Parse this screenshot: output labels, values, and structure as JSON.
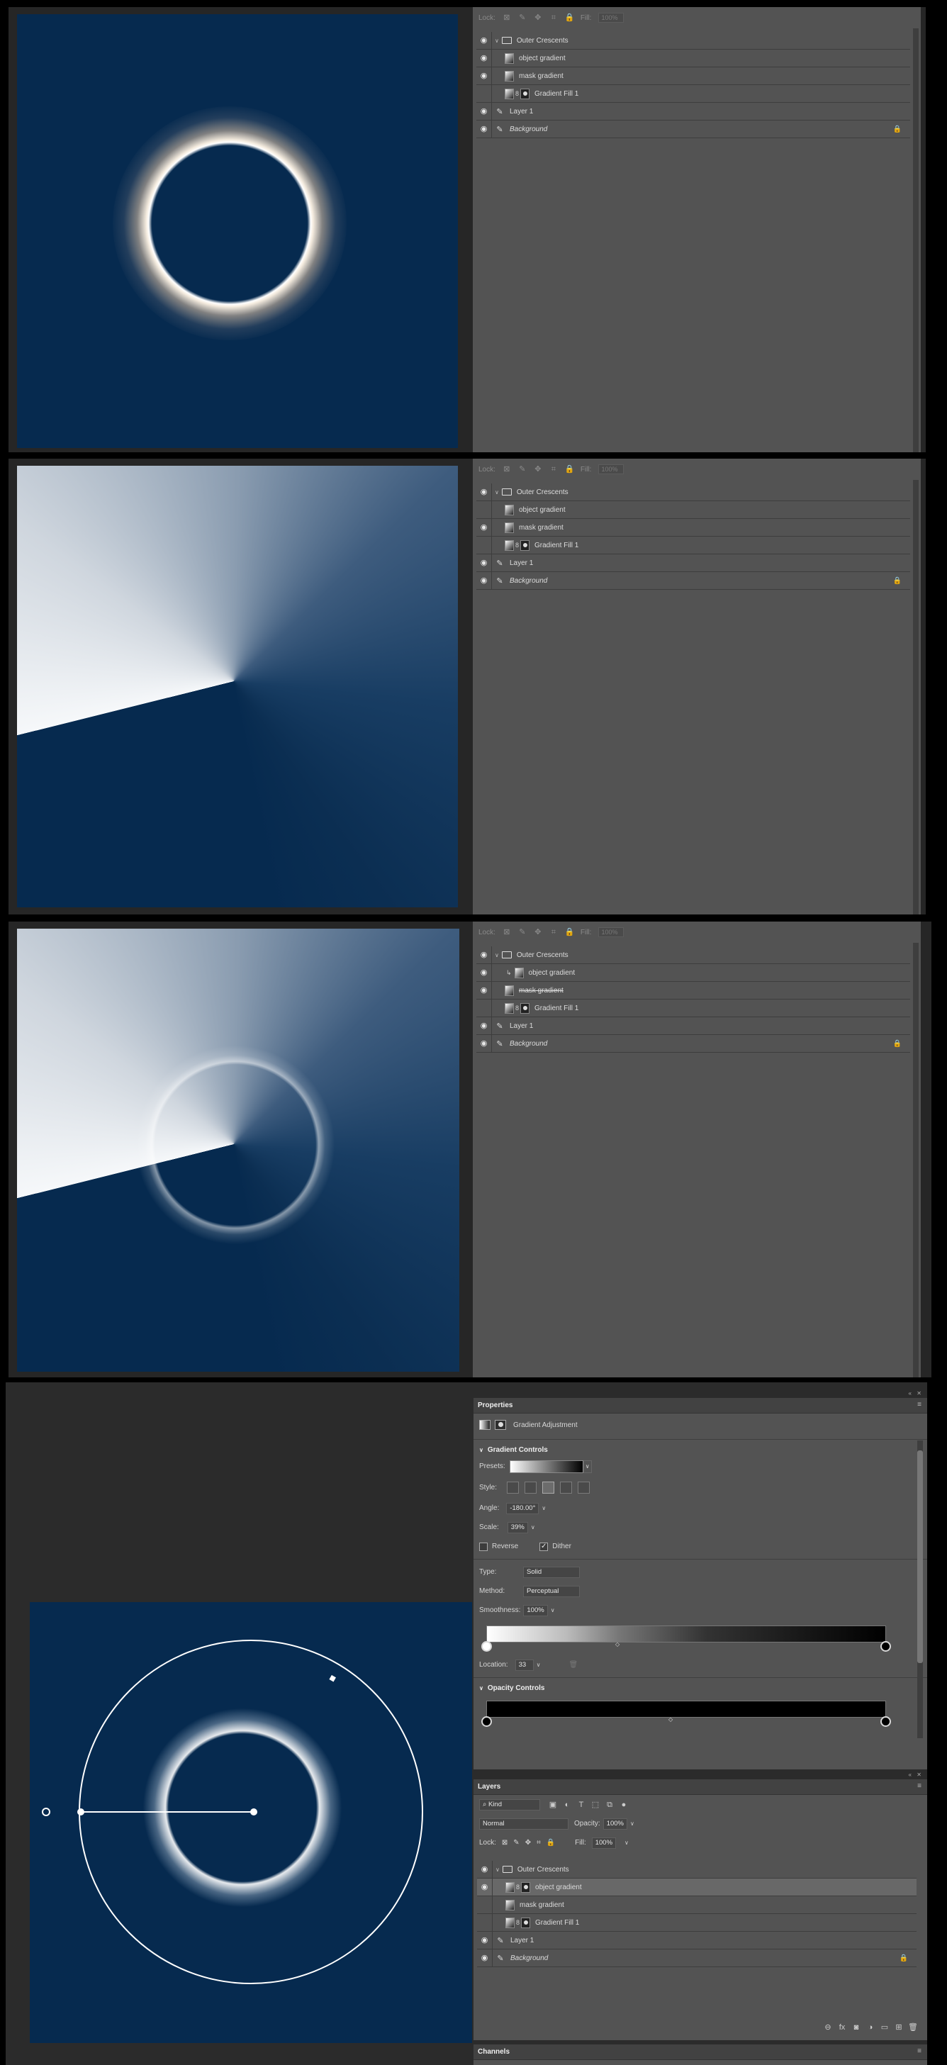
{
  "colors": {
    "canvas_bg": "#062a4f",
    "panel": "#535353",
    "panel_dark": "#424242",
    "selected_row": "#686868",
    "app_bg": "#262626"
  },
  "lockbar": {
    "lock_label": "Lock:",
    "fill_label": "Fill:",
    "fill_value": "100%"
  },
  "shots": [
    {
      "layers": [
        {
          "name": "Outer Crescents",
          "visible": true,
          "kind": "folder"
        },
        {
          "name": "object gradient",
          "visible": true,
          "kind": "gradient"
        },
        {
          "name": "mask gradient",
          "visible": true,
          "kind": "gradient"
        },
        {
          "name": "Gradient Fill 1",
          "visible": false,
          "kind": "fill"
        },
        {
          "name": "Layer 1",
          "visible": true,
          "kind": "brush"
        },
        {
          "name": "Background",
          "visible": true,
          "kind": "brush",
          "locked": true
        }
      ]
    },
    {
      "layers": [
        {
          "name": "Outer Crescents",
          "visible": true,
          "kind": "folder"
        },
        {
          "name": "object gradient",
          "visible": false,
          "kind": "gradient"
        },
        {
          "name": "mask gradient",
          "visible": true,
          "kind": "gradient"
        },
        {
          "name": "Gradient Fill 1",
          "visible": false,
          "kind": "fill"
        },
        {
          "name": "Layer 1",
          "visible": true,
          "kind": "brush"
        },
        {
          "name": "Background",
          "visible": true,
          "kind": "brush",
          "locked": true
        }
      ]
    },
    {
      "layers": [
        {
          "name": "Outer Crescents",
          "visible": true,
          "kind": "folder"
        },
        {
          "name": "object gradient",
          "visible": true,
          "kind": "gradient",
          "clipped": true
        },
        {
          "name": "mask gradient",
          "visible": true,
          "kind": "gradient",
          "strike": true
        },
        {
          "name": "Gradient Fill 1",
          "visible": false,
          "kind": "fill"
        },
        {
          "name": "Layer 1",
          "visible": true,
          "kind": "brush"
        },
        {
          "name": "Background",
          "visible": true,
          "kind": "brush",
          "locked": true
        }
      ]
    }
  ],
  "properties": {
    "tab": "Properties",
    "adjustment_title": "Gradient Adjustment",
    "section": "Gradient Controls",
    "presets_label": "Presets:",
    "style_label": "Style:",
    "angle_label": "Angle:",
    "angle_value": "-180.00°",
    "scale_label": "Scale:",
    "scale_value": "39%",
    "reverse_label": "Reverse",
    "reverse_checked": false,
    "dither_label": "Dither",
    "dither_checked": true,
    "type_label": "Type:",
    "type_value": "Solid",
    "method_label": "Method:",
    "method_value": "Perceptual",
    "smoothness_label": "Smoothness:",
    "smoothness_value": "100%",
    "location_label": "Location:",
    "location_value": "33",
    "opacity_section": "Opacity Controls"
  },
  "layers_panel": {
    "tab": "Layers",
    "kind_value": "Kind",
    "blend_value": "Normal",
    "opacity_label": "Opacity:",
    "opacity_value": "100%",
    "lock_label": "Lock:",
    "fill_label": "Fill:",
    "fill_value": "100%",
    "layers": [
      {
        "name": "Outer Crescents",
        "visible": true,
        "kind": "folder"
      },
      {
        "name": "object gradient",
        "visible": true,
        "kind": "fill",
        "selected": true
      },
      {
        "name": "mask gradient",
        "visible": false,
        "kind": "gradient"
      },
      {
        "name": "Gradient Fill 1",
        "visible": false,
        "kind": "fill"
      },
      {
        "name": "Layer 1",
        "visible": true,
        "kind": "brush"
      },
      {
        "name": "Background",
        "visible": true,
        "kind": "brush",
        "locked": true
      }
    ],
    "bottom_icons": [
      "link-icon",
      "fx-icon",
      "mask-icon",
      "adjustment-icon",
      "folder-icon",
      "new-layer-icon",
      "trash-icon"
    ]
  },
  "channels_tab": "Channels"
}
